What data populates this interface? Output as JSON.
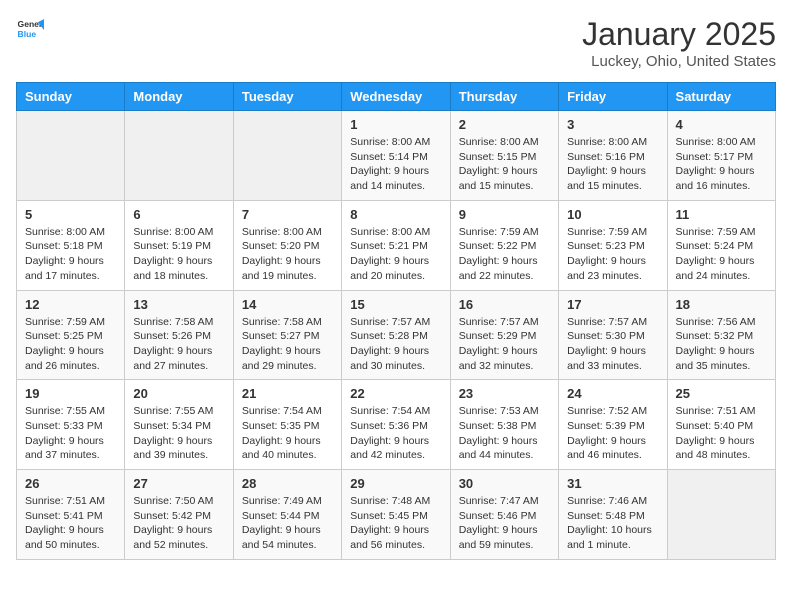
{
  "header": {
    "logo_general": "General",
    "logo_blue": "Blue",
    "month": "January 2025",
    "location": "Luckey, Ohio, United States"
  },
  "days_of_week": [
    "Sunday",
    "Monday",
    "Tuesday",
    "Wednesday",
    "Thursday",
    "Friday",
    "Saturday"
  ],
  "weeks": [
    [
      {
        "day": "",
        "info": ""
      },
      {
        "day": "",
        "info": ""
      },
      {
        "day": "",
        "info": ""
      },
      {
        "day": "1",
        "info": "Sunrise: 8:00 AM\nSunset: 5:14 PM\nDaylight: 9 hours\nand 14 minutes."
      },
      {
        "day": "2",
        "info": "Sunrise: 8:00 AM\nSunset: 5:15 PM\nDaylight: 9 hours\nand 15 minutes."
      },
      {
        "day": "3",
        "info": "Sunrise: 8:00 AM\nSunset: 5:16 PM\nDaylight: 9 hours\nand 15 minutes."
      },
      {
        "day": "4",
        "info": "Sunrise: 8:00 AM\nSunset: 5:17 PM\nDaylight: 9 hours\nand 16 minutes."
      }
    ],
    [
      {
        "day": "5",
        "info": "Sunrise: 8:00 AM\nSunset: 5:18 PM\nDaylight: 9 hours\nand 17 minutes."
      },
      {
        "day": "6",
        "info": "Sunrise: 8:00 AM\nSunset: 5:19 PM\nDaylight: 9 hours\nand 18 minutes."
      },
      {
        "day": "7",
        "info": "Sunrise: 8:00 AM\nSunset: 5:20 PM\nDaylight: 9 hours\nand 19 minutes."
      },
      {
        "day": "8",
        "info": "Sunrise: 8:00 AM\nSunset: 5:21 PM\nDaylight: 9 hours\nand 20 minutes."
      },
      {
        "day": "9",
        "info": "Sunrise: 7:59 AM\nSunset: 5:22 PM\nDaylight: 9 hours\nand 22 minutes."
      },
      {
        "day": "10",
        "info": "Sunrise: 7:59 AM\nSunset: 5:23 PM\nDaylight: 9 hours\nand 23 minutes."
      },
      {
        "day": "11",
        "info": "Sunrise: 7:59 AM\nSunset: 5:24 PM\nDaylight: 9 hours\nand 24 minutes."
      }
    ],
    [
      {
        "day": "12",
        "info": "Sunrise: 7:59 AM\nSunset: 5:25 PM\nDaylight: 9 hours\nand 26 minutes."
      },
      {
        "day": "13",
        "info": "Sunrise: 7:58 AM\nSunset: 5:26 PM\nDaylight: 9 hours\nand 27 minutes."
      },
      {
        "day": "14",
        "info": "Sunrise: 7:58 AM\nSunset: 5:27 PM\nDaylight: 9 hours\nand 29 minutes."
      },
      {
        "day": "15",
        "info": "Sunrise: 7:57 AM\nSunset: 5:28 PM\nDaylight: 9 hours\nand 30 minutes."
      },
      {
        "day": "16",
        "info": "Sunrise: 7:57 AM\nSunset: 5:29 PM\nDaylight: 9 hours\nand 32 minutes."
      },
      {
        "day": "17",
        "info": "Sunrise: 7:57 AM\nSunset: 5:30 PM\nDaylight: 9 hours\nand 33 minutes."
      },
      {
        "day": "18",
        "info": "Sunrise: 7:56 AM\nSunset: 5:32 PM\nDaylight: 9 hours\nand 35 minutes."
      }
    ],
    [
      {
        "day": "19",
        "info": "Sunrise: 7:55 AM\nSunset: 5:33 PM\nDaylight: 9 hours\nand 37 minutes."
      },
      {
        "day": "20",
        "info": "Sunrise: 7:55 AM\nSunset: 5:34 PM\nDaylight: 9 hours\nand 39 minutes."
      },
      {
        "day": "21",
        "info": "Sunrise: 7:54 AM\nSunset: 5:35 PM\nDaylight: 9 hours\nand 40 minutes."
      },
      {
        "day": "22",
        "info": "Sunrise: 7:54 AM\nSunset: 5:36 PM\nDaylight: 9 hours\nand 42 minutes."
      },
      {
        "day": "23",
        "info": "Sunrise: 7:53 AM\nSunset: 5:38 PM\nDaylight: 9 hours\nand 44 minutes."
      },
      {
        "day": "24",
        "info": "Sunrise: 7:52 AM\nSunset: 5:39 PM\nDaylight: 9 hours\nand 46 minutes."
      },
      {
        "day": "25",
        "info": "Sunrise: 7:51 AM\nSunset: 5:40 PM\nDaylight: 9 hours\nand 48 minutes."
      }
    ],
    [
      {
        "day": "26",
        "info": "Sunrise: 7:51 AM\nSunset: 5:41 PM\nDaylight: 9 hours\nand 50 minutes."
      },
      {
        "day": "27",
        "info": "Sunrise: 7:50 AM\nSunset: 5:42 PM\nDaylight: 9 hours\nand 52 minutes."
      },
      {
        "day": "28",
        "info": "Sunrise: 7:49 AM\nSunset: 5:44 PM\nDaylight: 9 hours\nand 54 minutes."
      },
      {
        "day": "29",
        "info": "Sunrise: 7:48 AM\nSunset: 5:45 PM\nDaylight: 9 hours\nand 56 minutes."
      },
      {
        "day": "30",
        "info": "Sunrise: 7:47 AM\nSunset: 5:46 PM\nDaylight: 9 hours\nand 59 minutes."
      },
      {
        "day": "31",
        "info": "Sunrise: 7:46 AM\nSunset: 5:48 PM\nDaylight: 10 hours\nand 1 minute."
      },
      {
        "day": "",
        "info": ""
      }
    ]
  ]
}
